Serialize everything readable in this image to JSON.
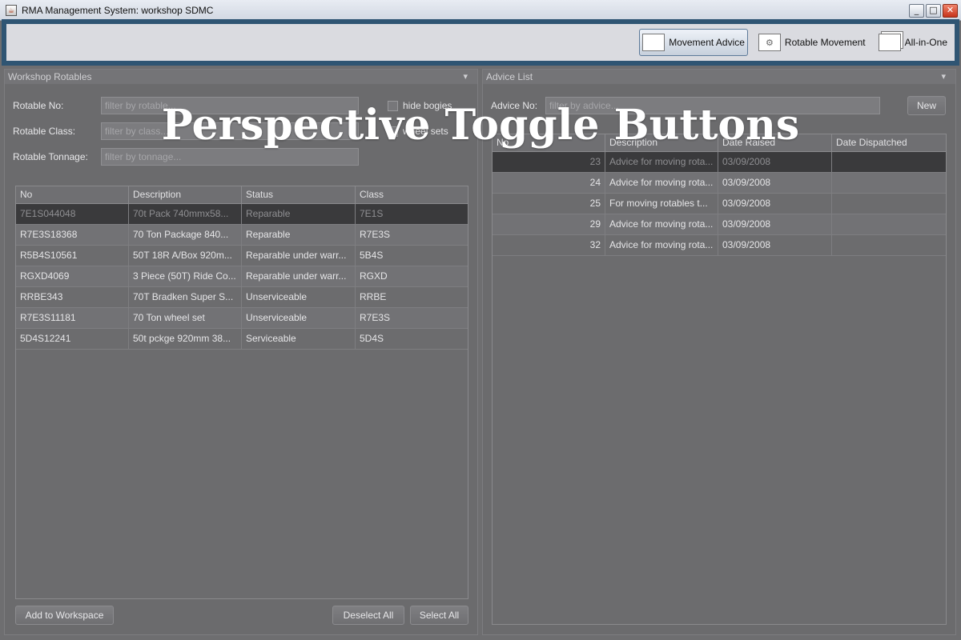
{
  "window": {
    "title": "RMA Management System: workshop SDMC",
    "controls": [
      "_",
      "□",
      "✕"
    ]
  },
  "perspectives": [
    {
      "label": "Movement Advice",
      "icon": "blank-window-icon",
      "active": true
    },
    {
      "label": "Rotable Movement",
      "icon": "gear-icon",
      "active": false
    },
    {
      "label": "All-in-One",
      "icon": "multi-window-icon",
      "active": false
    }
  ],
  "overlay": {
    "text": "Perspective Toggle Buttons"
  },
  "workshop_rotables": {
    "title": "Workshop Rotables",
    "fields": {
      "rotable_no": {
        "label": "Rotable No:",
        "placeholder": "filter by rotable..."
      },
      "rotable_class": {
        "label": "Rotable Class:",
        "placeholder": "filter by class..."
      },
      "rotable_tonnage": {
        "label": "Rotable Tonnage:",
        "placeholder": "filter by tonnage..."
      }
    },
    "hide_bogies": "hide bogies",
    "wheel_sets": "wheel sets",
    "columns": [
      "No",
      "Description",
      "Status",
      "Class"
    ],
    "rows": [
      [
        "7E1S044048",
        "70t Pack 740mmx58...",
        "Reparable",
        "7E1S"
      ],
      [
        "R7E3S18368",
        "70 Ton Package 840...",
        "Reparable",
        "R7E3S"
      ],
      [
        "R5B4S10561",
        "50T 18R A/Box 920m...",
        "Reparable under warr...",
        "5B4S"
      ],
      [
        "RGXD4069",
        "3 Piece (50T) Ride Co...",
        "Reparable under warr...",
        "RGXD"
      ],
      [
        "RRBE343",
        "70T Bradken Super S...",
        "Unserviceable",
        "RRBE"
      ],
      [
        "R7E3S11181",
        "70 Ton wheel set",
        "Unserviceable",
        "R7E3S"
      ],
      [
        "5D4S12241",
        "50t pckge 920mm 38...",
        "Serviceable",
        "5D4S"
      ]
    ],
    "buttons": {
      "add": "Add to Workspace",
      "deselect": "Deselect All",
      "select": "Select All"
    }
  },
  "advice_list": {
    "title": "Advice List",
    "field": {
      "label": "Advice No:",
      "placeholder": "filter by advice..."
    },
    "new_button": "New",
    "columns": [
      "No",
      "Description",
      "Date Raised",
      "Date Dispatched"
    ],
    "rows": [
      [
        "23",
        "Advice for moving rota...",
        "03/09/2008",
        ""
      ],
      [
        "24",
        "Advice for moving rota...",
        "03/09/2008",
        ""
      ],
      [
        "25",
        "For moving rotables t...",
        "03/09/2008",
        ""
      ],
      [
        "29",
        "Advice for moving rota...",
        "03/09/2008",
        ""
      ],
      [
        "32",
        "Advice for moving rota...",
        "03/09/2008",
        ""
      ]
    ]
  }
}
